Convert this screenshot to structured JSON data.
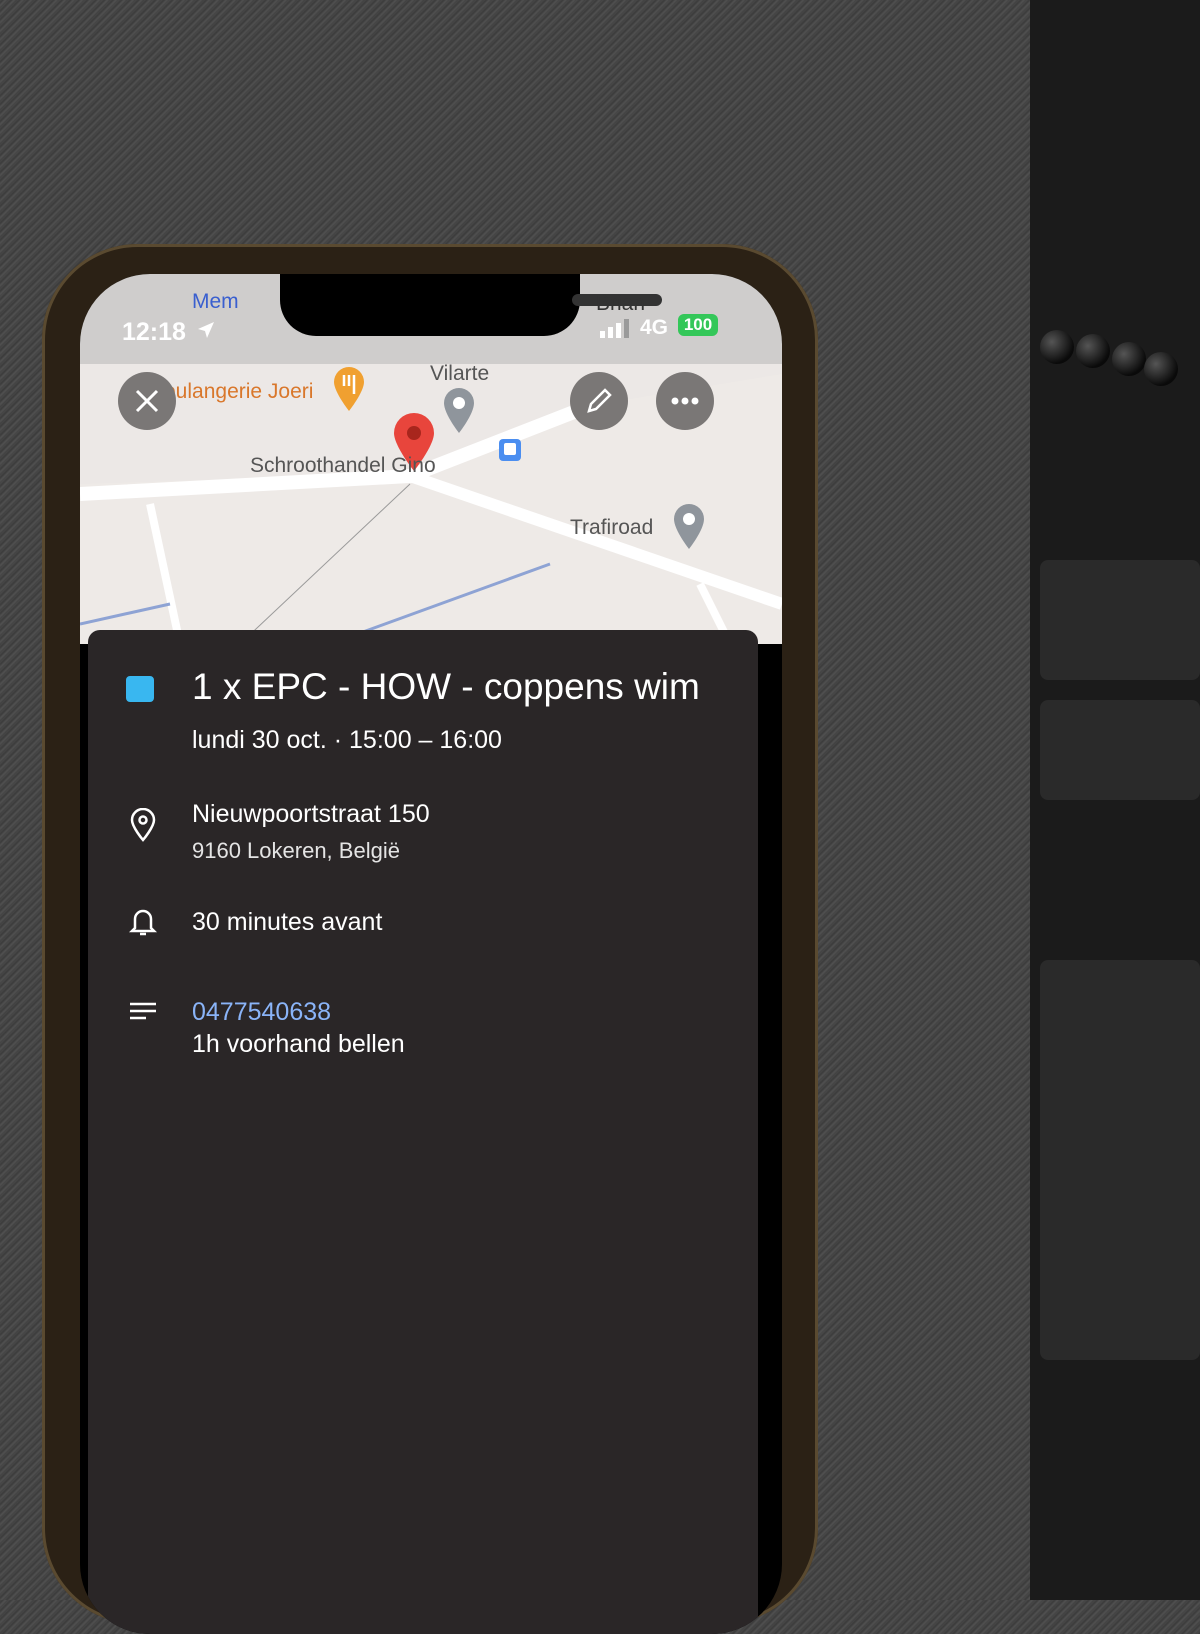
{
  "status_bar": {
    "time": "12:18",
    "back_app": "Mem",
    "right_label": "Brian",
    "network": "4G",
    "battery": "100"
  },
  "map": {
    "place_bakery": "Boulangerie Joeri",
    "place_vilarte": "Vilarte",
    "place_scrap": "Schroothandel Gino",
    "place_trafiroad": "Trafiroad"
  },
  "event": {
    "title": "1 x EPC - HOW - coppens wim",
    "datetime": "lundi 30 oct. · 15:00 – 16:00",
    "color": "#39b7f0",
    "address_line1": "Nieuwpoortstraat 150",
    "address_line2": "9160 Lokeren, België",
    "notification": "30 minutes avant",
    "phone": "0477540638",
    "note": "1h voorhand bellen"
  },
  "icons": [
    "close-icon",
    "edit-icon",
    "more-icon",
    "location-pin-icon",
    "bell-icon",
    "notes-icon"
  ]
}
